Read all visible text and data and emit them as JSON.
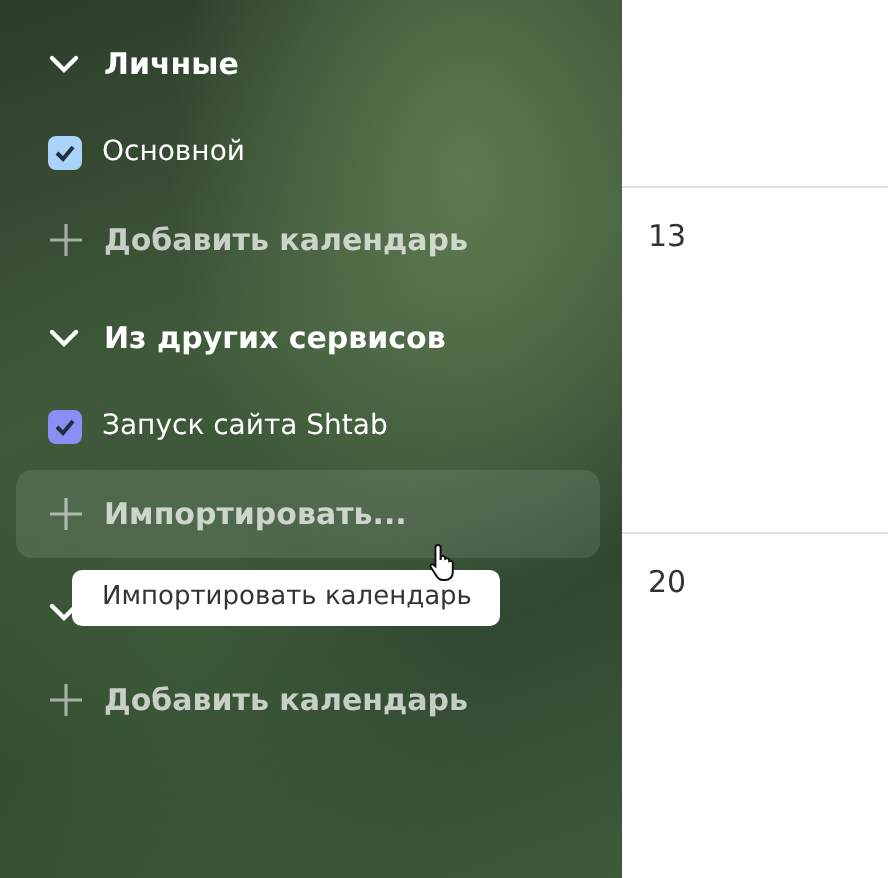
{
  "sidebar": {
    "sections": [
      {
        "title": "Личные",
        "expanded": true,
        "calendars": [
          {
            "name": "Основной",
            "checked": true,
            "color": "#a9d3fb"
          }
        ],
        "add_action": {
          "label": "Добавить календарь",
          "hovered": false
        }
      },
      {
        "title": "Из других сервисов",
        "expanded": true,
        "calendars": [
          {
            "name": "Запуск сайта Shtab",
            "checked": true,
            "color": "#8b8ef5"
          }
        ],
        "add_action": {
          "label": "Импортировать...",
          "hovered": true
        }
      },
      {
        "expanded": true,
        "add_action": {
          "label": "Добавить календарь",
          "hovered": false
        }
      }
    ]
  },
  "tooltip": {
    "text": "Импортировать календарь"
  },
  "calendar": {
    "days": [
      "13",
      "20"
    ]
  }
}
